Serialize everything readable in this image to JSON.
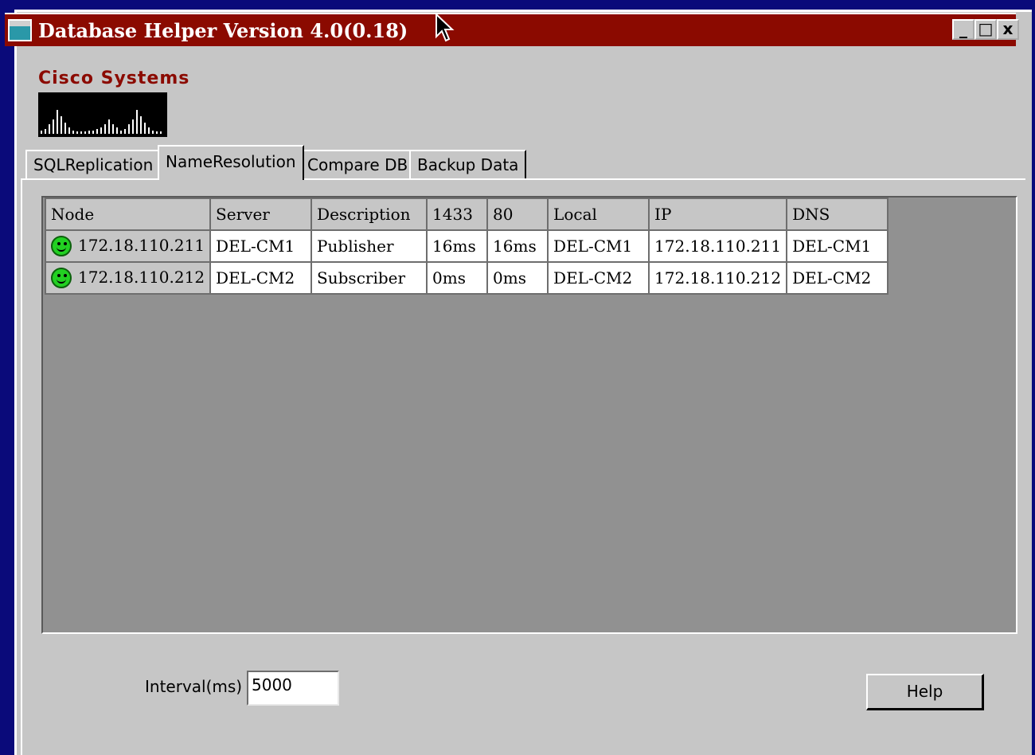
{
  "window": {
    "title": "Database Helper Version 4.0(0.18)",
    "controls": [
      "_",
      "□",
      "x"
    ]
  },
  "logo": {
    "text": "Cisco Systems"
  },
  "tabs": [
    {
      "label": "SQLReplication",
      "active": false
    },
    {
      "label": "NameResolution",
      "active": true
    },
    {
      "label": "Compare DB",
      "active": false
    },
    {
      "label": "Backup Data",
      "active": false
    }
  ],
  "grid": {
    "columns": [
      "Node",
      "Server",
      "Description",
      "1433",
      "80",
      "Local",
      "IP",
      "DNS"
    ],
    "rows": [
      {
        "node": "172.18.110.211",
        "status": "smiley-ok-icon",
        "server": "DEL-CM1",
        "description": "Publisher",
        "p1433": "16ms",
        "p80": "16ms",
        "local": "DEL-CM1",
        "ip": "172.18.110.211",
        "dns": "DEL-CM1"
      },
      {
        "node": "172.18.110.212",
        "status": "smiley-ok-icon",
        "server": "DEL-CM2",
        "description": "Subscriber",
        "p1433": "0ms",
        "p80": "0ms",
        "local": "DEL-CM2",
        "ip": "172.18.110.212",
        "dns": "DEL-CM2"
      }
    ]
  },
  "interval": {
    "label": "Interval(ms)",
    "value": "5000"
  },
  "help_button": {
    "label": "Help"
  },
  "colors": {
    "titlebar": "#8b0a00",
    "status_ok": "#22d022",
    "desktop": "#0a0a7a"
  }
}
